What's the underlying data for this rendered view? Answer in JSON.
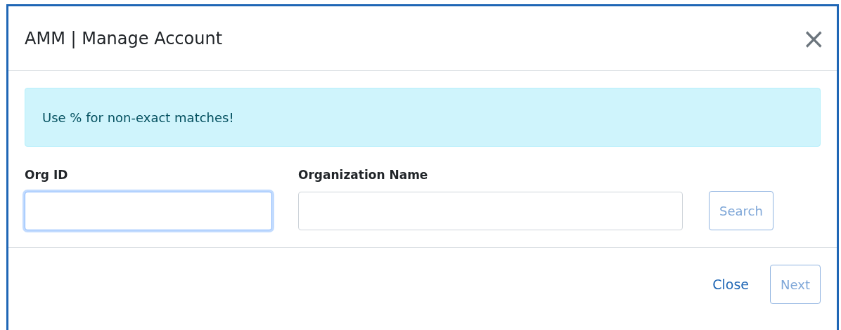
{
  "dialog": {
    "title": "AMM | Manage Account",
    "close_icon": "×"
  },
  "alert": {
    "text": "Use % for non-exact matches!"
  },
  "fields": [
    {
      "label": "Org ID",
      "focused": true
    },
    {
      "label": "Organization Name",
      "focused": false
    }
  ],
  "search_button": {
    "label": "Search",
    "disabled": true
  },
  "footer": {
    "close_link": "Close",
    "next_button": {
      "label": "Next",
      "disabled": true
    }
  }
}
